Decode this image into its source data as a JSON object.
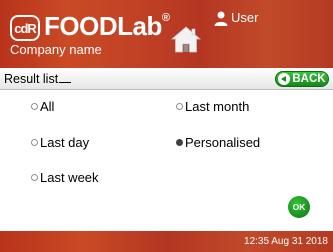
{
  "header": {
    "logo_badge": "cdR",
    "brand_name": "FOODLab",
    "brand_mark": "®",
    "company_name": "Company name",
    "user_label": "User",
    "icons": {
      "home": "home-icon",
      "user": "user-icon"
    }
  },
  "titlebar": {
    "title": "Result list",
    "back_label": "BACK"
  },
  "options": [
    {
      "label": "All",
      "checked": false
    },
    {
      "label": "Last month",
      "checked": false
    },
    {
      "label": "Last day",
      "checked": false
    },
    {
      "label": "Personalised",
      "checked": true
    },
    {
      "label": "Last week",
      "checked": false
    }
  ],
  "ok_label": "OK",
  "footer": {
    "datetime": "12:35  Aug 31 2018"
  },
  "colors": {
    "brand_red": "#b8331b",
    "accent_green": "#13891a"
  }
}
